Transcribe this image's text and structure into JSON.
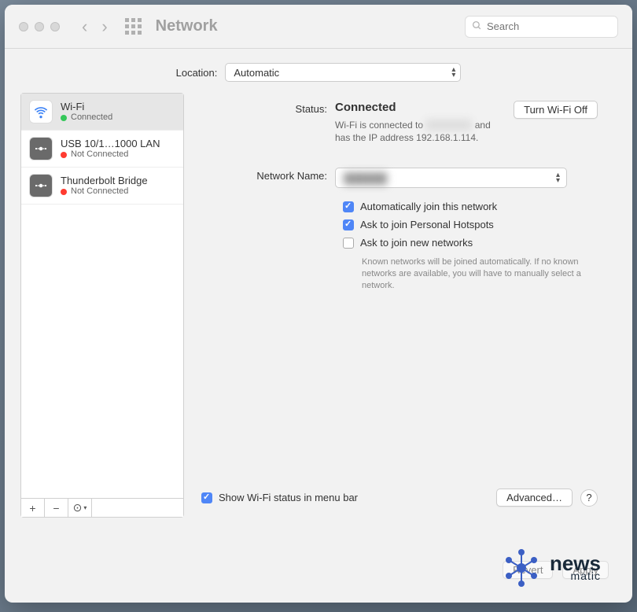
{
  "titlebar": {
    "title": "Network",
    "search_placeholder": "Search"
  },
  "location": {
    "label": "Location:",
    "value": "Automatic"
  },
  "sidebar": {
    "items": [
      {
        "name": "Wi-Fi",
        "status": "Connected",
        "status_color": "green",
        "icon": "wifi",
        "selected": true
      },
      {
        "name": "USB 10/1…1000 LAN",
        "status": "Not Connected",
        "status_color": "red",
        "icon": "eth",
        "selected": false
      },
      {
        "name": "Thunderbolt Bridge",
        "status": "Not Connected",
        "status_color": "red",
        "icon": "eth",
        "selected": false
      }
    ],
    "toolbar": {
      "add": "+",
      "remove": "−",
      "actions": "⊙"
    }
  },
  "detail": {
    "status_label": "Status:",
    "status_value": "Connected",
    "wifi_toggle": "Turn Wi-Fi Off",
    "status_desc_pre": "Wi-Fi is connected to ",
    "status_desc_net": "██████",
    "status_desc_post": " and has the IP address 192.168.1.114.",
    "netname_label": "Network Name:",
    "netname_value": "██████",
    "check_auto_join": "Automatically join this network",
    "check_ask_hotspot": "Ask to join Personal Hotspots",
    "check_ask_new": "Ask to join new networks",
    "help_text": "Known networks will be joined automatically. If no known networks are available, you will have to manually select a network.",
    "show_menubar": "Show Wi-Fi status in menu bar",
    "advanced": "Advanced…",
    "help": "?"
  },
  "buttons": {
    "revert": "Revert",
    "apply": "Apply"
  },
  "watermark": {
    "line1": "news",
    "line2": "matic"
  }
}
